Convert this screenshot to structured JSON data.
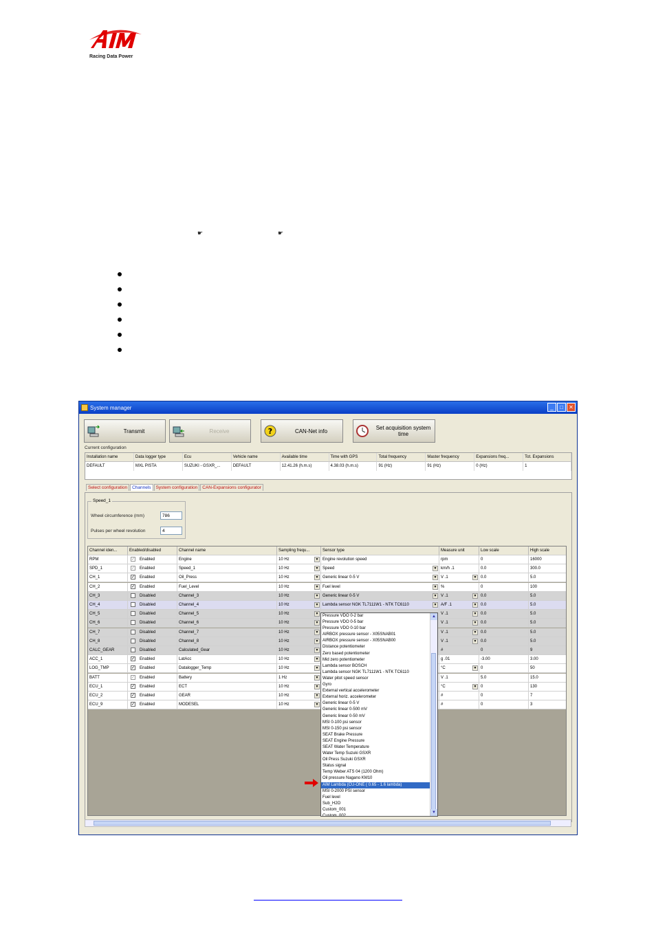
{
  "logo": {
    "subtitle": "Racing Data Power"
  },
  "window": {
    "title": "System manager",
    "toolbar": {
      "transmit": "Transmit",
      "receive": "Receive",
      "can_info": "CAN-Net info",
      "set_acq": "Set acquisition system time"
    },
    "current_config_label": "Current configuration",
    "config": {
      "headers": [
        "Installation name",
        "Data logger type",
        "Ecu",
        "Vehicle name",
        "Available time",
        "Time with GPS",
        "Total frequency",
        "Master frequency",
        "Expansions freq...",
        "Tot. Expansions"
      ],
      "row": [
        "DEFAULT",
        "MXL PISTA",
        "SUZUKI - GSXR_...",
        "DEFAULT",
        "12.41.26 (h.m.s)",
        "4.38.03 (h.m.s)",
        "91 (Hz)",
        "91 (Hz)",
        "0 (Hz)",
        "1"
      ]
    },
    "tabs": [
      "Select configuration",
      "Channels",
      "System configuration",
      "CAN-Expansions configurator"
    ],
    "speed": {
      "title": "Speed_1",
      "wheel_label": "Wheel circumference    (mm)",
      "wheel_value": "786",
      "pulses_label": "Pulses per wheel revolution",
      "pulses_value": "4"
    },
    "grid": {
      "headers": [
        "Channel iden...",
        "Enabled/disabled",
        "Channel name",
        "Sampling frequ...",
        "Sensor type",
        "Measure unit",
        "Low scale",
        "High scale"
      ],
      "rows": [
        [
          "RPM",
          "Enabled",
          "Engine",
          "10 Hz",
          "Engine revolution speed",
          "rpm",
          "0",
          "16000"
        ],
        [
          "SPD_1",
          "Enabled",
          "Speed_1",
          "10 Hz",
          "Speed",
          "km/h  .1",
          "0.0",
          "300.0"
        ],
        [
          "CH_1",
          "Enabled",
          "Oil_Press",
          "10 Hz",
          "Generic linear 0-5 V",
          "V  .1",
          "0.0",
          "5.0"
        ],
        [
          "CH_2",
          "Enabled",
          "Fuel_Level",
          "10 Hz",
          "Fuel level",
          "%",
          "0",
          "100"
        ],
        [
          "CH_3",
          "Disabled",
          "Channel_3",
          "10 Hz",
          "Generic linear 0-5 V",
          "V  .1",
          "0.0",
          "5.0"
        ],
        [
          "CH_4",
          "Disabled",
          "Channel_4",
          "10 Hz",
          "Lambda sensor NGK TL7111W1 - NTK TC6110",
          "A/F  .1",
          "0.0",
          "5.0"
        ],
        [
          "CH_5",
          "Disabled",
          "Channel_5",
          "10 Hz",
          "",
          "V  .1",
          "0.0",
          "5.0"
        ],
        [
          "CH_6",
          "Disabled",
          "Channel_6",
          "10 Hz",
          "",
          "V  .1",
          "0.0",
          "5.0"
        ],
        [
          "CH_7",
          "Disabled",
          "Channel_7",
          "10 Hz",
          "",
          "V  .1",
          "0.0",
          "5.0"
        ],
        [
          "CH_8",
          "Disabled",
          "Channel_8",
          "10 Hz",
          "",
          "V  .1",
          "0.0",
          "5.0"
        ],
        [
          "CALC_GEAR",
          "Disabled",
          "Calculated_Gear",
          "10 Hz",
          "",
          "#",
          "0",
          "9"
        ],
        [
          "ACC_1",
          "Enabled",
          "LatAcc",
          "10 Hz",
          "",
          "g  .01",
          "-3.00",
          "3.00"
        ],
        [
          "LOG_TMP",
          "Enabled",
          "Datalogger_Temp",
          "10 Hz",
          "",
          "°C",
          "0",
          "50"
        ],
        [
          "BATT",
          "Enabled",
          "Battery",
          "1 Hz",
          "",
          "V  .1",
          "5.0",
          "15.0"
        ],
        [
          "ECU_1",
          "Enabled",
          "ECT",
          "10 Hz",
          "",
          "°C",
          "0",
          "130"
        ],
        [
          "ECU_2",
          "Enabled",
          "GEAR",
          "10 Hz",
          "",
          "#",
          "0",
          "7"
        ],
        [
          "ECU_9",
          "Enabled",
          "MODESEL",
          "10 Hz",
          "",
          "#",
          "0",
          "3"
        ]
      ]
    },
    "dropdown_items": [
      "Pressure VDO 0-2 bar",
      "Pressure VDO 0-5 bar",
      "Pressure VDO 0-10 bar",
      "AIRBOX pressure sensor - X05SNAB01",
      "AIRBOX pressure sensor - X05SNAB00",
      "Distance potentiometer",
      "Zero based potentiometer",
      "Mid zero potentiometer",
      "Lambda sensor BOSCH",
      "Lambda sensor NGK TL7111W1 - NTK TC6110",
      "Water pitot speed sensor",
      "Gyro",
      "External vertical accelerometer",
      "External horiz. accelerometer",
      "Generic linear 0-5 V",
      "Generic linear 0-500 mV",
      "Generic linear 0-50 mV",
      "MSI 0-100 psi sensor",
      "MSI 0-150 psi sensor",
      "SEAT Brake Pressure",
      "SEAT Engine Pressure",
      "SEAT Water Temperature",
      "Water Temp Suzuki GSXR",
      "Oil Press Suzuki GSXR",
      "Status signal",
      "Temp Weber ATS 04 (1200 Ohm)",
      "Oil pressure Nagano KM10",
      "AIM Lambda (CU-ONE ( 0.65 - 1.6 lambda)",
      "MSI 0-2000 PSI sensor",
      "Fuel level",
      "Sub_H2O",
      "Custom_001",
      "Custom_002"
    ],
    "selected_item": "AIM Lambda (CU-ONE ( 0.65 - 1.6 lambda)"
  },
  "colors": {
    "accent_red": "#e00000",
    "title_blue": "#0a3fc6",
    "selection_blue": "#316ac5"
  }
}
